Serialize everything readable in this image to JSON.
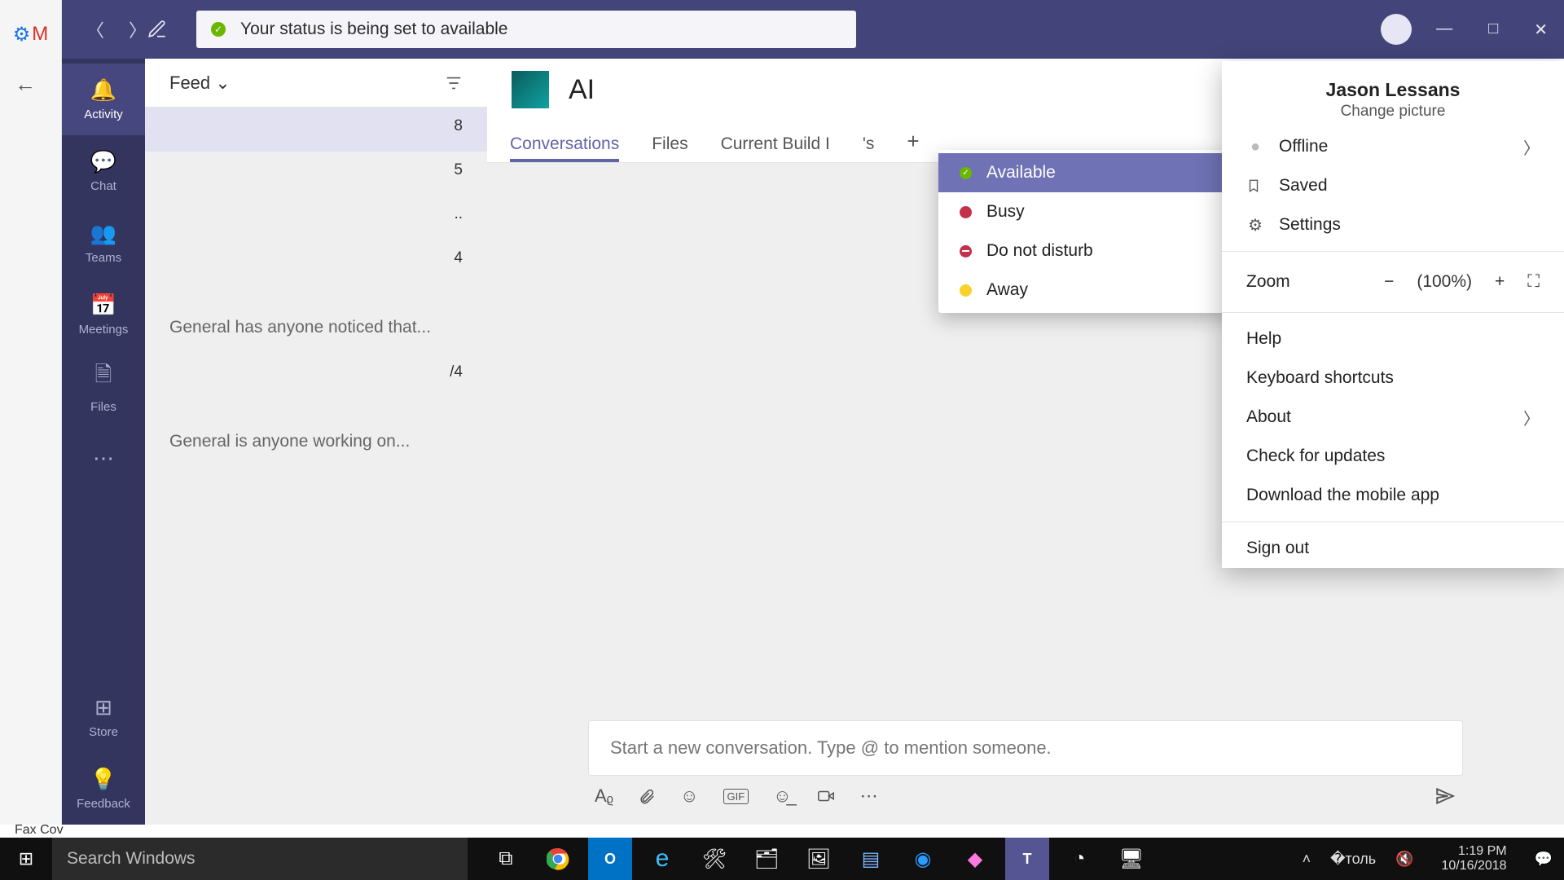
{
  "titlebar": {
    "status_text": "Your status is being set to available"
  },
  "rail": {
    "activity": "Activity",
    "chat": "Chat",
    "teams": "Teams",
    "meetings": "Meetings",
    "files": "Files",
    "store": "Store",
    "feedback": "Feedback"
  },
  "feed": {
    "label": "Feed",
    "items": [
      {
        "count": "8",
        "preview": ""
      },
      {
        "count": "5",
        "preview": ""
      },
      {
        "count": "..",
        "preview": ""
      },
      {
        "count": "4",
        "preview": "General has anyone noticed that..."
      },
      {
        "count": "/4",
        "preview": "General is anyone working on..."
      }
    ]
  },
  "channel": {
    "name": "AI",
    "tabs": {
      "conversations": "Conversations",
      "files": "Files",
      "current": "Current Build I",
      "extra": "'s"
    }
  },
  "status_popup": {
    "available": "Available",
    "busy": "Busy",
    "dnd": "Do not disturb",
    "away": "Away"
  },
  "profile": {
    "name": "Jason Lessans",
    "change_picture": "Change picture",
    "offline": "Offline",
    "saved": "Saved",
    "settings": "Settings",
    "zoom_label": "Zoom",
    "zoom_value": "(100%)",
    "help": "Help",
    "shortcuts": "Keyboard shortcuts",
    "about": "About",
    "updates": "Check for updates",
    "download": "Download the mobile app",
    "signout": "Sign out"
  },
  "composer": {
    "placeholder": "Start a new conversation. Type @ to mention someone."
  },
  "taskbar": {
    "search": "Search Windows",
    "time": "1:19 PM",
    "date": "10/16/2018"
  },
  "misc": {
    "faxcov": "Fax Cov"
  }
}
